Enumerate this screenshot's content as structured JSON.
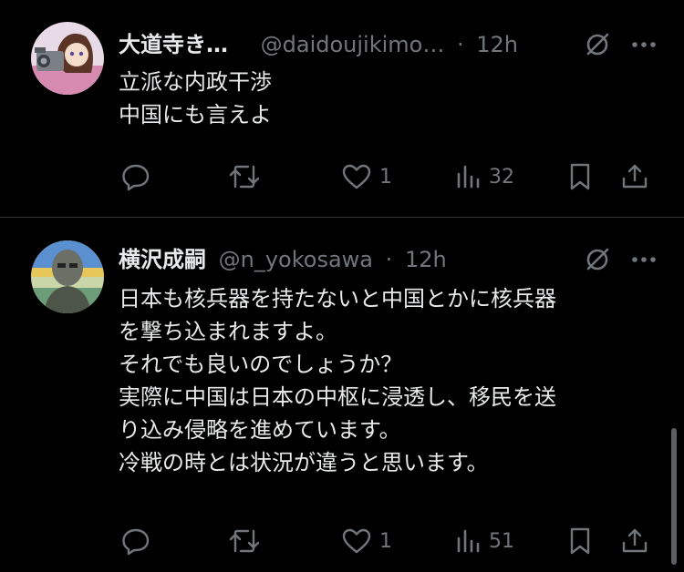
{
  "tweets": [
    {
      "name": "大道寺き…",
      "handle": "@daidoujikimo…",
      "sep": "·",
      "time": "12h",
      "lines": [
        "立派な内政干渉",
        "中国にも言えよ"
      ],
      "likes": "1",
      "views": "32"
    },
    {
      "name": "横沢成嗣",
      "handle": "@n_yokosawa",
      "sep": "·",
      "time": "12h",
      "lines": [
        "日本も核兵器を持たないと中国とかに核兵器",
        "を撃ち込まれますよ。",
        "それでも良いのでしょうか？",
        "実際に中国は日本の中枢に浸透し、移民を送",
        "り込み侵略を進めています。",
        "冷戦の時とは状況が違うと思います。"
      ],
      "likes": "1",
      "views": "51"
    }
  ],
  "colors": {
    "background": "#000000",
    "text": "#e7e9ea",
    "muted": "#71767b",
    "divider": "#2f3336"
  },
  "icons": [
    "grok-icon",
    "more-icon",
    "reply-icon",
    "retweet-icon",
    "like-icon",
    "views-icon",
    "bookmark-icon",
    "share-icon"
  ]
}
